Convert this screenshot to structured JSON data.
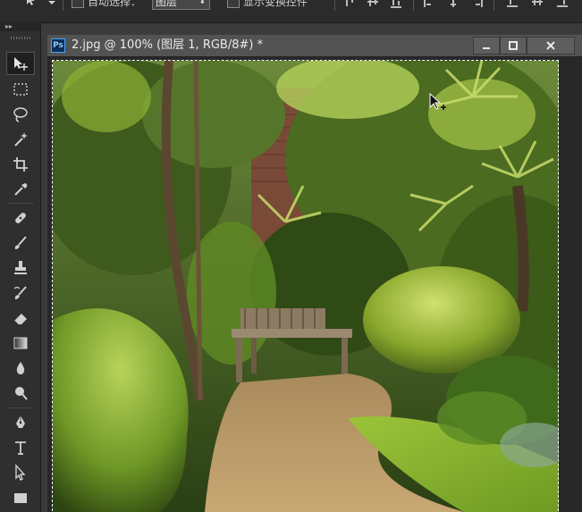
{
  "options_bar": {
    "auto_select_label": "自动选择：",
    "auto_select_value": "图层",
    "show_transform_label": "显示变换控件"
  },
  "tools": [
    {
      "name": "move-tool",
      "icon": "move-icon",
      "active": true
    },
    {
      "name": "marquee-tool",
      "icon": "rectangular-marquee-icon"
    },
    {
      "name": "lasso-tool",
      "icon": "lasso-icon"
    },
    {
      "name": "magic-wand-tool",
      "icon": "magic-wand-icon"
    },
    {
      "name": "crop-tool",
      "icon": "crop-icon"
    },
    {
      "name": "eyedropper-tool",
      "icon": "eyedropper-icon"
    },
    {
      "name": "healing-brush-tool",
      "icon": "bandage-icon"
    },
    {
      "name": "brush-tool",
      "icon": "brush-icon"
    },
    {
      "name": "clone-stamp-tool",
      "icon": "stamp-icon"
    },
    {
      "name": "history-brush-tool",
      "icon": "history-brush-icon"
    },
    {
      "name": "eraser-tool",
      "icon": "eraser-icon"
    },
    {
      "name": "gradient-tool",
      "icon": "gradient-icon"
    },
    {
      "name": "blur-tool",
      "icon": "drop-icon"
    },
    {
      "name": "dodge-tool",
      "icon": "dodge-icon"
    },
    {
      "name": "pen-tool",
      "icon": "pen-icon"
    },
    {
      "name": "type-tool",
      "icon": "type-icon"
    },
    {
      "name": "path-selection-tool",
      "icon": "arrow-icon"
    },
    {
      "name": "shape-tool",
      "icon": "rectangle-icon"
    }
  ],
  "document": {
    "app_badge": "Ps",
    "title": "2.jpg @ 100% (图层 1, RGB/8#) *",
    "image_description": "garden path with wooden bench surrounded by green foliage"
  },
  "window_buttons": {
    "minimize": "minimize-icon",
    "maximize": "maximize-icon",
    "close": "close-icon"
  },
  "colors": {
    "ui_dark": "#2b2b2b",
    "titlebar": "#535353",
    "canvas_bg": "#282828",
    "ps_blue": "#4aa3ff"
  }
}
